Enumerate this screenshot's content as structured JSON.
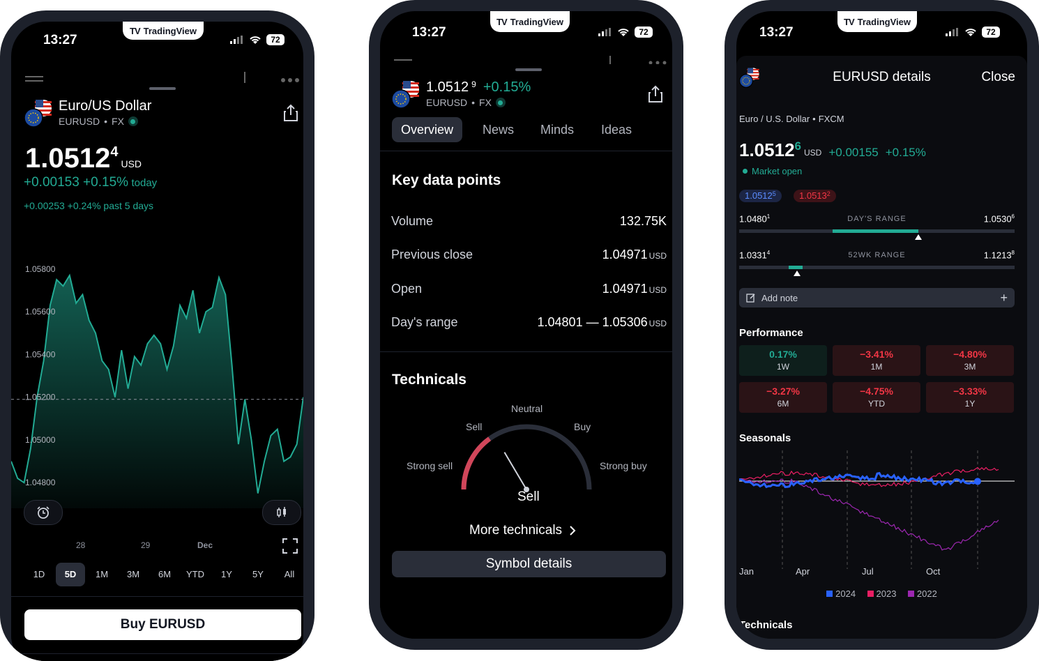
{
  "status_bar": {
    "time": "13:27",
    "battery": "72"
  },
  "brand": {
    "name": "TradingView",
    "logo": "TV"
  },
  "colors": {
    "accent_green": "#22ab94",
    "negative_red": "#f23645",
    "series_2024": "#2962ff",
    "series_2023": "#e91e63",
    "series_2022": "#9c27b0",
    "sell_gauge": "#d1465a"
  },
  "phone1": {
    "symbol_name": "Euro/US Dollar",
    "ticker": "EURUSD",
    "exchange": "FX",
    "price_main": "1.0512",
    "price_sup": "4",
    "currency": "USD",
    "change_today": "+0.00153 +0.15%",
    "change_today_suffix": "today",
    "change_5d": "+0.00253 +0.24% past 5 days",
    "x_ticks": [
      "28",
      "29",
      "Dec"
    ],
    "ranges": [
      "1D",
      "5D",
      "1M",
      "3M",
      "6M",
      "YTD",
      "1Y",
      "5Y",
      "All"
    ],
    "active_range": "5D",
    "buy_button": "Buy EURUSD"
  },
  "chart_data": {
    "type": "area",
    "title": "",
    "xlabel": "",
    "ylabel": "",
    "ylim": [
      1.0468,
      1.0592
    ],
    "y_ticks": [
      "1.05800",
      "1.05600",
      "1.05400",
      "1.05200",
      "1.05000",
      "1.04800"
    ],
    "x_tick_labels": [
      "28",
      "29",
      "Dec"
    ],
    "previous_close_line": 1.0519,
    "values": [
      1.049,
      1.0482,
      1.048,
      1.0496,
      1.052,
      1.0537,
      1.0563,
      1.0575,
      1.0572,
      1.0577,
      1.0564,
      1.0568,
      1.0556,
      1.055,
      1.0537,
      1.0533,
      1.052,
      1.0542,
      1.0524,
      1.0539,
      1.0535,
      1.0545,
      1.0549,
      1.0545,
      1.0533,
      1.0544,
      1.0563,
      1.0557,
      1.057,
      1.055,
      1.056,
      1.0562,
      1.0576,
      1.0568,
      1.0535,
      1.0498,
      1.0519,
      1.05,
      1.0475,
      1.049,
      1.0502,
      1.0505,
      1.049,
      1.0492,
      1.0498,
      1.052
    ]
  },
  "phone2": {
    "price_main": "1.0512",
    "price_sup": "9",
    "change_pct": "+0.15%",
    "ticker": "EURUSD",
    "exchange": "FX",
    "tabs": [
      "Overview",
      "News",
      "Minds",
      "Ideas"
    ],
    "active_tab": "Overview",
    "key_data_title": "Key data points",
    "key_data": [
      {
        "label": "Volume",
        "value": "132.75",
        "unit": "K"
      },
      {
        "label": "Previous close",
        "value": "1.04971",
        "unit": "USD"
      },
      {
        "label": "Open",
        "value": "1.04971",
        "unit": "USD"
      },
      {
        "label": "Day's range",
        "value": "1.04801 — 1.05306",
        "unit": "USD"
      }
    ],
    "technicals_title": "Technicals",
    "gauge": {
      "labels": {
        "strong_sell": "Strong sell",
        "sell": "Sell",
        "neutral": "Neutral",
        "buy": "Buy",
        "strong_buy": "Strong buy"
      },
      "reading": "Sell",
      "needle_value": 0.33
    },
    "more_technicals": "More technicals",
    "symbol_details_button": "Symbol details"
  },
  "phone3": {
    "title": "EURUSD details",
    "close": "Close",
    "subtitle": "Euro / U.S. Dollar",
    "source": "FXCM",
    "price_main": "1.0512",
    "price_sup": "6",
    "currency": "USD",
    "change_abs": "+0.00155",
    "change_pct": "+0.15%",
    "market_status": "Market open",
    "bid_main": "1.0512",
    "bid_sup": "5",
    "ask_main": "1.0513",
    "ask_sup": "2",
    "day_range": {
      "low_main": "1.0480",
      "low_sup": "1",
      "label": "DAY'S RANGE",
      "high_main": "1.0530",
      "high_sup": "6",
      "fill_from": 0.34,
      "fill_to": 0.65,
      "marker": 0.65
    },
    "wk52_range": {
      "low_main": "1.0331",
      "low_sup": "4",
      "label": "52WK RANGE",
      "high_main": "1.1213",
      "high_sup": "8",
      "fill_from": 0.18,
      "fill_to": 0.23,
      "marker": 0.21
    },
    "add_note": "Add note",
    "performance_title": "Performance",
    "performance": [
      {
        "value": "0.17%",
        "label": "1W",
        "positive": true
      },
      {
        "value": "−3.41%",
        "label": "1M",
        "positive": false
      },
      {
        "value": "−4.80%",
        "label": "3M",
        "positive": false
      },
      {
        "value": "−3.27%",
        "label": "6M",
        "positive": false
      },
      {
        "value": "−4.75%",
        "label": "YTD",
        "positive": false
      },
      {
        "value": "−3.33%",
        "label": "1Y",
        "positive": false
      }
    ],
    "seasonals_title": "Seasonals",
    "seasonals_months": [
      "Jan",
      "Apr",
      "Jul",
      "Oct"
    ],
    "seasonals_legend": [
      "2024",
      "2023",
      "2022"
    ],
    "technicals_peek": "Technicals"
  }
}
